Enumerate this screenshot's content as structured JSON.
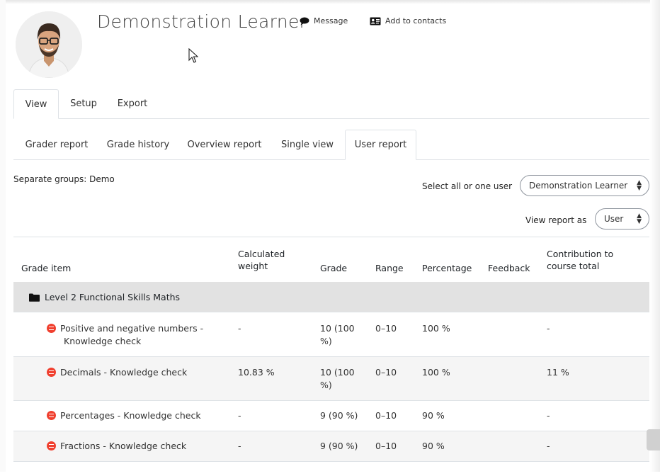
{
  "header": {
    "name": "Demonstration Learner",
    "message_label": "Message",
    "contacts_label": "Add to contacts"
  },
  "tabs_primary": [
    {
      "label": "View",
      "active": true
    },
    {
      "label": "Setup",
      "active": false
    },
    {
      "label": "Export",
      "active": false
    }
  ],
  "tabs_secondary": [
    {
      "label": "Grader report",
      "active": false
    },
    {
      "label": "Grade history",
      "active": false
    },
    {
      "label": "Overview report",
      "active": false
    },
    {
      "label": "Single view",
      "active": false
    },
    {
      "label": "User report",
      "active": true
    }
  ],
  "filters": {
    "groups_label": "Separate groups: Demo",
    "user_select_label": "Select all or one user",
    "user_select_value": "Demonstration Learner",
    "view_as_label": "View report as",
    "view_as_value": "User"
  },
  "table": {
    "headers": {
      "grade_item": "Grade item",
      "weight_1": "Calculated",
      "weight_2": "weight",
      "grade": "Grade",
      "range": "Range",
      "percentage": "Percentage",
      "feedback": "Feedback",
      "contribution_1": "Contribution to",
      "contribution_2": "course total"
    },
    "category": "Level 2 Functional Skills Maths",
    "rows": [
      {
        "item_1": "Positive and negative numbers -",
        "item_2": "Knowledge check",
        "weight": "-",
        "grade_1": "10 (100",
        "grade_2": "%)",
        "range": "0–10",
        "percentage": "100 %",
        "feedback": "",
        "contribution": "-"
      },
      {
        "item_1": "Decimals - Knowledge check",
        "item_2": "",
        "weight": "10.83 %",
        "grade_1": "10 (100",
        "grade_2": "%)",
        "range": "0–10",
        "percentage": "100 %",
        "feedback": "",
        "contribution": "11 %"
      },
      {
        "item_1": "Percentages - Knowledge check",
        "item_2": "",
        "weight": "-",
        "grade_1": "9 (90 %)",
        "grade_2": "",
        "range": "0–10",
        "percentage": "90 %",
        "feedback": "",
        "contribution": "-"
      },
      {
        "item_1": "Fractions - Knowledge check",
        "item_2": "",
        "weight": "-",
        "grade_1": "9 (90 %)",
        "grade_2": "",
        "range": "0–10",
        "percentage": "90 %",
        "feedback": "",
        "contribution": "-"
      }
    ]
  },
  "colors": {
    "item_icon": "#f0402f",
    "category_bg": "#e2e2e2",
    "stripe_bg": "#f5f5f5",
    "border": "#dee2e6"
  },
  "icons": {
    "message": "speech-bubble-icon",
    "contacts": "address-card-icon",
    "category": "folder-icon",
    "item": "quiz-icon"
  }
}
